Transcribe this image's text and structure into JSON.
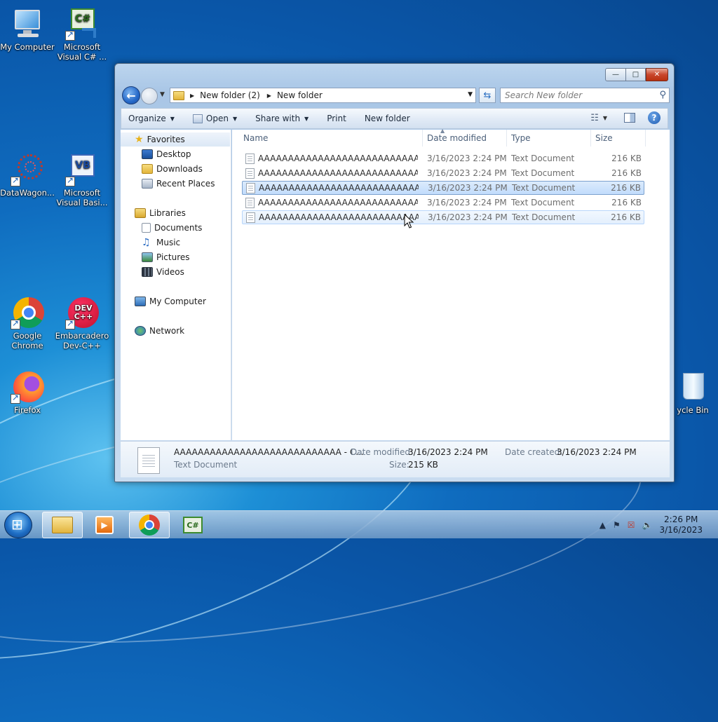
{
  "desktop": {
    "icons": [
      {
        "label": "My Computer"
      },
      {
        "label": "Microsoft Visual C# ..."
      },
      {
        "label": "DataWagon..."
      },
      {
        "label": "Microsoft Visual Basi..."
      },
      {
        "label": "Google Chrome"
      },
      {
        "label": "Embarcadero Dev-C++"
      },
      {
        "label": "Firefox"
      },
      {
        "label": "ycle Bin"
      }
    ],
    "icon_glyphs": {
      "csharp": "C#",
      "vb": "VB",
      "devcpp": "DEV C++"
    }
  },
  "window": {
    "controls": {
      "minimize": "—",
      "maximize": "□",
      "close": "✕"
    },
    "breadcrumb": [
      "New folder (2)",
      "New folder"
    ],
    "search_placeholder": "Search New folder",
    "toolbar": {
      "organize": "Organize",
      "open": "Open",
      "share_with": "Share with",
      "print": "Print",
      "new_folder": "New folder"
    },
    "nav": {
      "favorites": "Favorites",
      "desktop": "Desktop",
      "downloads": "Downloads",
      "recent_places": "Recent Places",
      "libraries": "Libraries",
      "documents": "Documents",
      "music": "Music",
      "pictures": "Pictures",
      "videos": "Videos",
      "my_computer": "My Computer",
      "network": "Network"
    },
    "columns": {
      "name": "Name",
      "date_modified": "Date modified",
      "type": "Type",
      "size": "Size"
    },
    "files": [
      {
        "name": "AAAAAAAAAAAAAAAAAAAAAAAAAAAA...",
        "date": "3/16/2023 2:24 PM",
        "type": "Text Document",
        "size": "216 KB",
        "state": "normal"
      },
      {
        "name": "AAAAAAAAAAAAAAAAAAAAAAAAAAAA...",
        "date": "3/16/2023 2:24 PM",
        "type": "Text Document",
        "size": "216 KB",
        "state": "normal"
      },
      {
        "name": "AAAAAAAAAAAAAAAAAAAAAAAAAAAA...",
        "date": "3/16/2023 2:24 PM",
        "type": "Text Document",
        "size": "216 KB",
        "state": "selected"
      },
      {
        "name": "AAAAAAAAAAAAAAAAAAAAAAAAAAAA...",
        "date": "3/16/2023 2:24 PM",
        "type": "Text Document",
        "size": "216 KB",
        "state": "normal"
      },
      {
        "name": "AAAAAAAAAAAAAAAAAAAAAAAAAAAA",
        "date": "3/16/2023 2:24 PM",
        "type": "Text Document",
        "size": "216 KB",
        "state": "hover"
      }
    ],
    "details": {
      "name": "AAAAAAAAAAAAAAAAAAAAAAAAAAAA - C...",
      "type": "Text Document",
      "date_modified_label": "Date modified:",
      "date_modified": "3/16/2023 2:24 PM",
      "size_label": "Size:",
      "size": "215 KB",
      "date_created_label": "Date created:",
      "date_created": "3/16/2023 2:24 PM"
    }
  },
  "taskbar": {
    "clock_time": "2:26 PM",
    "clock_date": "3/16/2023",
    "csharp_glyph": "C#"
  }
}
